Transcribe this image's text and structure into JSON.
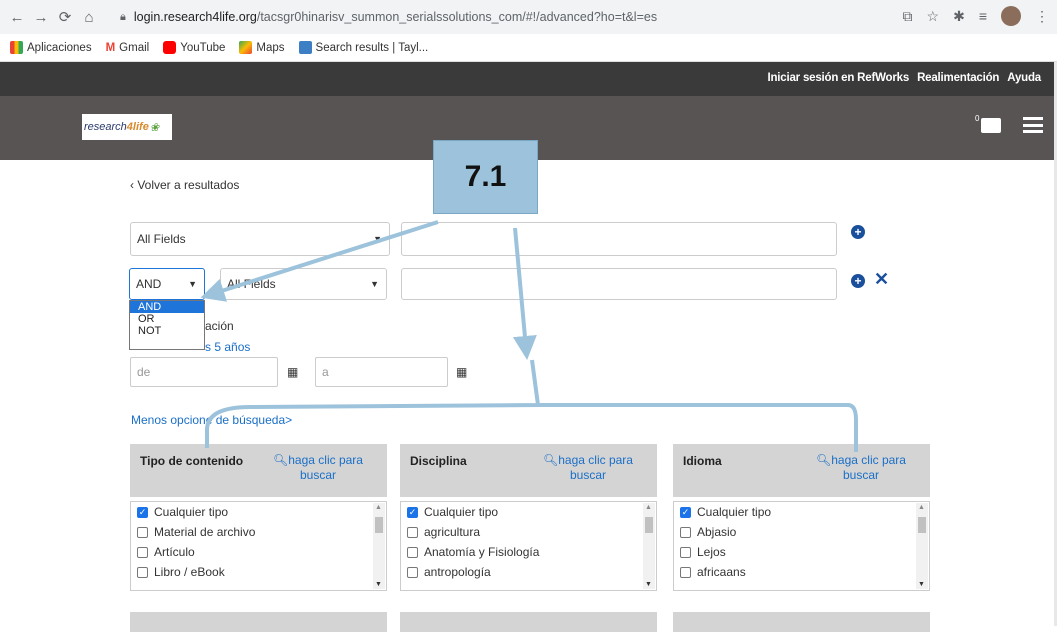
{
  "browser": {
    "url_domain": "login.research4life.org",
    "url_path": "/tacsgr0hinarisv_summon_serialssolutions_com/#!/advanced?ho=t&l=es",
    "bookmarks": [
      "Aplicaciones",
      "Gmail",
      "YouTube",
      "Maps",
      "Search results | Tayl..."
    ]
  },
  "header": {
    "links": [
      "Iniciar sesión en RefWorks",
      "Realimentación",
      "Ayuda"
    ],
    "logo_text": "research4life",
    "cart_count": "0"
  },
  "page": {
    "back_link": "‹ Volver a resultados",
    "row1_field": "All Fields",
    "row2_operator": "AND",
    "row2_field": "All Fields",
    "operator_options": [
      "AND",
      "OR",
      "NOT"
    ],
    "date_label_partial": "ación",
    "date_link_partial": "s 5 años",
    "date_from_placeholder": "de",
    "date_to_placeholder": "a",
    "less_options_link": "Menos opcione  de búsqueda>"
  },
  "facets": [
    {
      "title": "Tipo de contenido",
      "search_label": "haga clic para buscar",
      "items": [
        {
          "label": "Cualquier tipo",
          "checked": true
        },
        {
          "label": "Material de archivo",
          "checked": false
        },
        {
          "label": "Artículo",
          "checked": false
        },
        {
          "label": "Libro / eBook",
          "checked": false
        }
      ]
    },
    {
      "title": "Disciplina",
      "search_label": "haga clic para buscar",
      "items": [
        {
          "label": "Cualquier tipo",
          "checked": true
        },
        {
          "label": "agricultura",
          "checked": false
        },
        {
          "label": "Anatomía y Fisiología",
          "checked": false
        },
        {
          "label": "antropología",
          "checked": false
        }
      ]
    },
    {
      "title": "Idioma",
      "search_label": "haga clic para buscar",
      "items": [
        {
          "label": "Cualquier tipo",
          "checked": true
        },
        {
          "label": "Abjasio",
          "checked": false
        },
        {
          "label": "Lejos",
          "checked": false
        },
        {
          "label": "africaans",
          "checked": false
        }
      ]
    }
  ],
  "annotation": {
    "label": "7.1",
    "color": "#9cc3db"
  },
  "colors": {
    "topbar": "#3a3a3a",
    "brandbar": "#595454",
    "link": "#1a6fc7",
    "accent": "#1a4f9c",
    "selected": "#1e74d8"
  }
}
